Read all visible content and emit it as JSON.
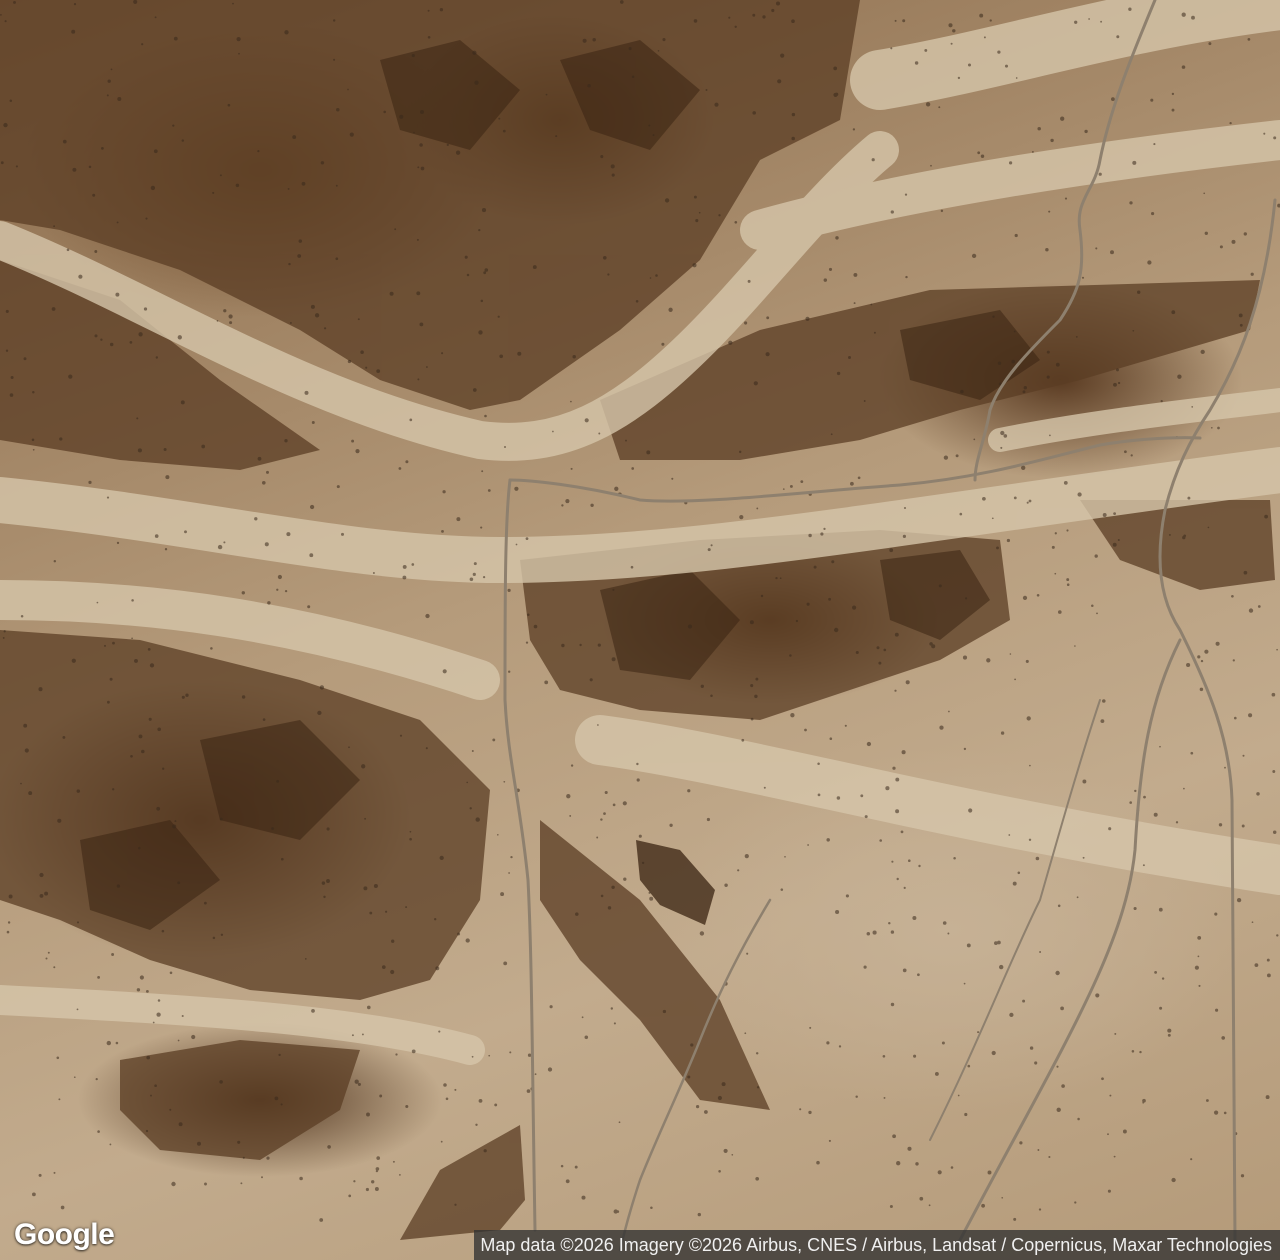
{
  "map": {
    "type": "satellite",
    "terrain": "desert mountains with alluvial washes",
    "roads_visible": true
  },
  "branding": {
    "logo_text": "Google"
  },
  "attribution": {
    "text": "Map data ©2026 Imagery ©2026 Airbus, CNES / Airbus, Landsat / Copernicus, Maxar Technologies"
  },
  "colors": {
    "wash": "#d3c2a6",
    "mountain_dark": "#4a2f1a",
    "mountain_mid": "#7a5636",
    "road": "#8a7a66"
  }
}
